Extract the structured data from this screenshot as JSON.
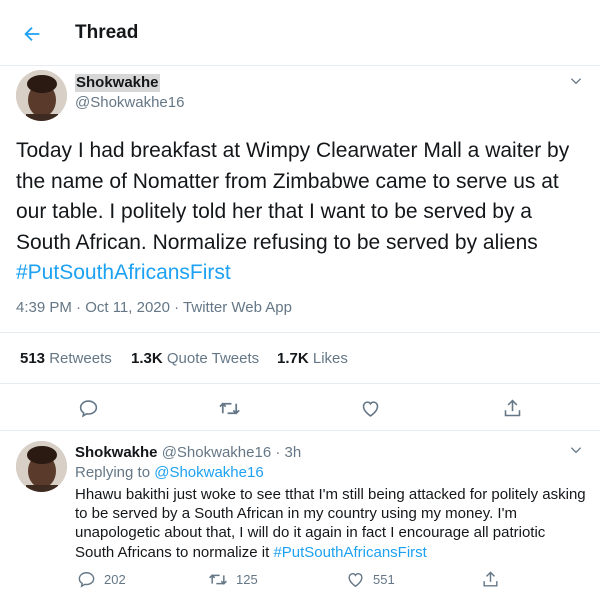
{
  "header": {
    "title": "Thread",
    "back_icon": "arrow-left-icon"
  },
  "main_tweet": {
    "display_name": "Shokwakhe",
    "handle": "@Shokwakhe16",
    "text_before": "Today I had breakfast at Wimpy Clearwater Mall a waiter by the name of Nomatter from Zimbabwe came to serve us at our table. I politely told her that I want to be served by a South African. Normalize refusing to be served by aliens ",
    "hashtag": "#PutSouthAfricansFirst",
    "timestamp": "4:39 PM · Oct 11, 2020 · Twitter Web App",
    "stats": {
      "retweets_count": "513",
      "retweets_label": "Retweets",
      "quotes_count": "1.3K",
      "quotes_label": "Quote Tweets",
      "likes_count": "1.7K",
      "likes_label": "Likes"
    }
  },
  "reply_tweet": {
    "display_name": "Shokwakhe",
    "handle_time": "@Shokwakhe16 · 3h",
    "replying_prefix": "Replying to ",
    "replying_to": "@Shokwakhe16",
    "text_before": "Hhawu bakithi just woke to see tthat I'm still being attacked for politely asking to be served by a South African in my country using my money. I'm unapologetic about that, I will do it again in fact I encourage all patriotic South Africans to normalize it ",
    "hashtag": "#PutSouthAfricansFirst",
    "reply_count": "202",
    "retweet_count": "125",
    "like_count": "551"
  },
  "colors": {
    "accent": "#1da1f2",
    "muted": "#657786",
    "text": "#14171a",
    "border": "#e6ecf0"
  }
}
